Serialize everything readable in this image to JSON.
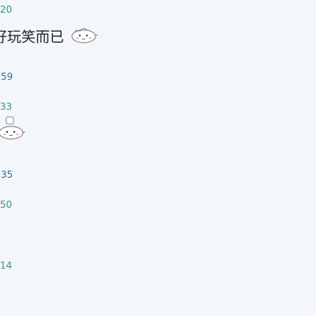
{
  "entries": [
    {
      "timestamp": "20",
      "message": "好玩笑而已",
      "emoticon": "blob-emoticon"
    },
    {
      "timestamp": ":59"
    },
    {
      "timestamp": "33",
      "emoticon": "blob-chef-emoticon"
    },
    {
      "timestamp": ":35"
    },
    {
      "timestamp": "50"
    },
    {
      "timestamp": "14"
    }
  ],
  "colors": {
    "background": "#f3f6fa",
    "timestamp_green": "#3e9a6d",
    "timestamp_blue": "#2a6fa8",
    "message_text": "#222222"
  }
}
